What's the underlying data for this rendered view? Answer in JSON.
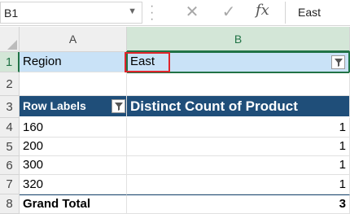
{
  "formula_bar": {
    "name_box": "B1",
    "cancel_icon": "cancel-icon",
    "enter_icon": "enter-icon",
    "fx_label": "fx",
    "formula_value": "East"
  },
  "columns": [
    "A",
    "B"
  ],
  "rows": [
    "1",
    "2",
    "3",
    "4",
    "5",
    "6",
    "7",
    "8"
  ],
  "pivot": {
    "filter_label": "Region",
    "filter_value": "East",
    "row_labels_header": "Row Labels",
    "value_header": "Distinct Count of Product",
    "items": [
      {
        "label": "160",
        "value": "1"
      },
      {
        "label": "200",
        "value": "1"
      },
      {
        "label": "300",
        "value": "1"
      },
      {
        "label": "320",
        "value": "1"
      }
    ],
    "grand_total_label": "Grand Total",
    "grand_total_value": "3"
  },
  "colors": {
    "header_fill": "#1f4e79",
    "filter_fill": "#c9e2f7",
    "selection": "#217346",
    "highlight_box": "#e0242b"
  }
}
